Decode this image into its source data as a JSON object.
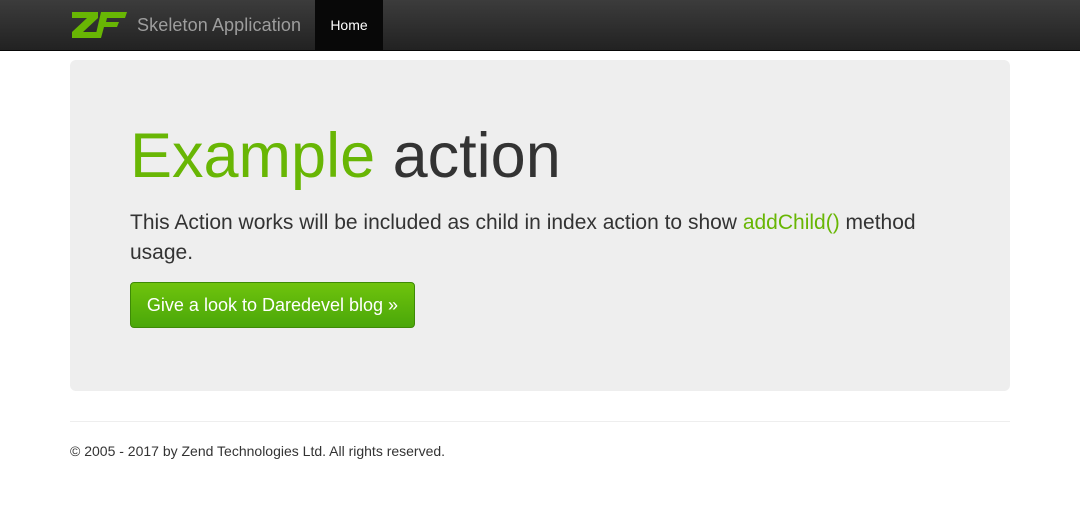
{
  "navbar": {
    "logo_icon": "zf-logo-icon",
    "brand_title": "Skeleton Application",
    "items": [
      {
        "label": "Home",
        "active": true
      }
    ],
    "background_color": "#222222",
    "active_item_color": "#080808"
  },
  "jumbotron": {
    "title_accent": "Example",
    "title_rest": " action",
    "lead_prefix": "This Action works will be included as child in index action to show ",
    "lead_link": "addChild()",
    "lead_suffix": " method usage.",
    "button_label": "Give a look to Daredevel blog »",
    "background_color": "#eeeeee",
    "accent_color": "#68b604"
  },
  "footer": {
    "text": "© 2005 - 2017 by Zend Technologies Ltd. All rights reserved."
  }
}
